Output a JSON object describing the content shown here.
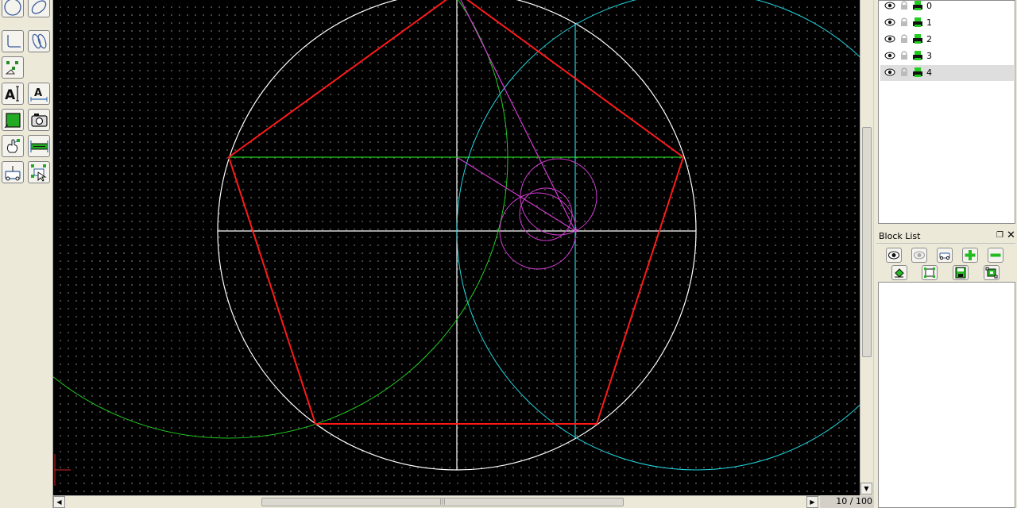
{
  "app": {
    "colors": {
      "canvas_bg": "#000000",
      "pentagon": "#ff1a1a",
      "construction_white": "#ffffff",
      "construction_green": "#22cc22",
      "construction_cyan": "#22d6e0",
      "construction_magenta": "#d23cd2"
    }
  },
  "toolbar": {
    "tools": [
      {
        "icon": "circle-icon"
      },
      {
        "icon": "ellipse-icon"
      },
      {
        "icon": "polyline-icon"
      },
      {
        "icon": "spline-icon"
      },
      {
        "icon": "points-icon"
      },
      {
        "icon": "text-icon"
      },
      {
        "icon": "dimension-text-icon"
      },
      {
        "icon": "hatch-icon"
      },
      {
        "icon": "image-icon"
      },
      {
        "icon": "modify-icon"
      },
      {
        "icon": "measure-icon"
      },
      {
        "icon": "block-icon"
      },
      {
        "icon": "select-icon"
      }
    ]
  },
  "status": {
    "zoom_readout": "10 / 100"
  },
  "layers": {
    "items": [
      {
        "name": "0",
        "selected": false
      },
      {
        "name": "1",
        "selected": false
      },
      {
        "name": "2",
        "selected": false
      },
      {
        "name": "3",
        "selected": false
      },
      {
        "name": "4",
        "selected": true
      }
    ]
  },
  "block_list": {
    "title": "Block List",
    "buttons": [
      {
        "icon": "show-block-icon"
      },
      {
        "icon": "hide-block-icon"
      },
      {
        "icon": "toggle-block-icon"
      },
      {
        "icon": "add-block-icon"
      },
      {
        "icon": "remove-block-icon"
      },
      {
        "icon": "rename-block-icon"
      },
      {
        "icon": "edit-block-icon"
      },
      {
        "icon": "save-block-icon"
      },
      {
        "icon": "insert-block-icon"
      }
    ]
  }
}
